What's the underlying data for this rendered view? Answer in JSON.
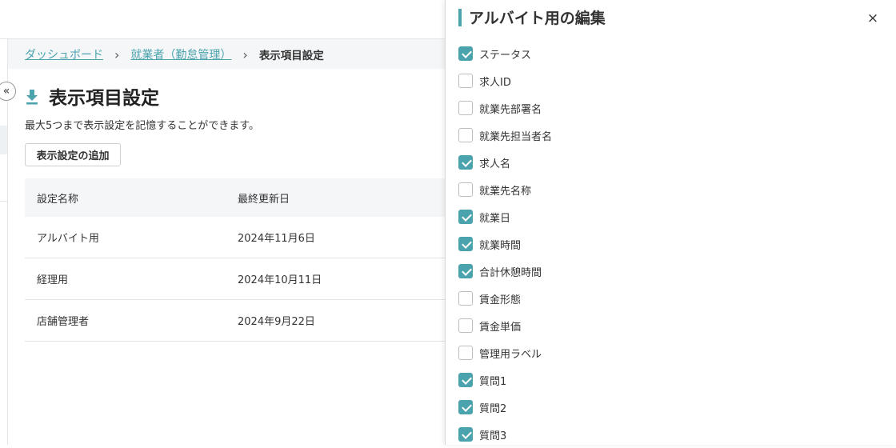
{
  "breadcrumb": {
    "items": [
      "ダッシュボード",
      "就業者（勤怠管理）"
    ],
    "current": "表示項目設定"
  },
  "page": {
    "title": "表示項目設定",
    "description": "最大5つまで表示設定を記憶することができます。",
    "add_button": "表示設定の追加"
  },
  "table": {
    "columns": [
      "設定名称",
      "最終更新日"
    ],
    "rows": [
      [
        "アルバイト用",
        "2024年11月6日"
      ],
      [
        "経理用",
        "2024年10月11日"
      ],
      [
        "店舗管理者",
        "2024年9月22日"
      ]
    ]
  },
  "drawer": {
    "title": "アルバイト用の編集",
    "close": "×",
    "items": [
      {
        "label": "ステータス",
        "checked": true
      },
      {
        "label": "求人ID",
        "checked": false
      },
      {
        "label": "就業先部署名",
        "checked": false
      },
      {
        "label": "就業先担当者名",
        "checked": false
      },
      {
        "label": "求人名",
        "checked": true
      },
      {
        "label": "就業先名称",
        "checked": false
      },
      {
        "label": "就業日",
        "checked": true
      },
      {
        "label": "就業時間",
        "checked": true
      },
      {
        "label": "合計休憩時間",
        "checked": true
      },
      {
        "label": "賃金形態",
        "checked": false
      },
      {
        "label": "賃金単価",
        "checked": false
      },
      {
        "label": "管理用ラベル",
        "checked": false
      },
      {
        "label": "質問1",
        "checked": true
      },
      {
        "label": "質問2",
        "checked": true
      },
      {
        "label": "質問3",
        "checked": true
      }
    ]
  },
  "colors": {
    "accent": "#4aa3ad",
    "header_bg": "#f4f6f8"
  }
}
